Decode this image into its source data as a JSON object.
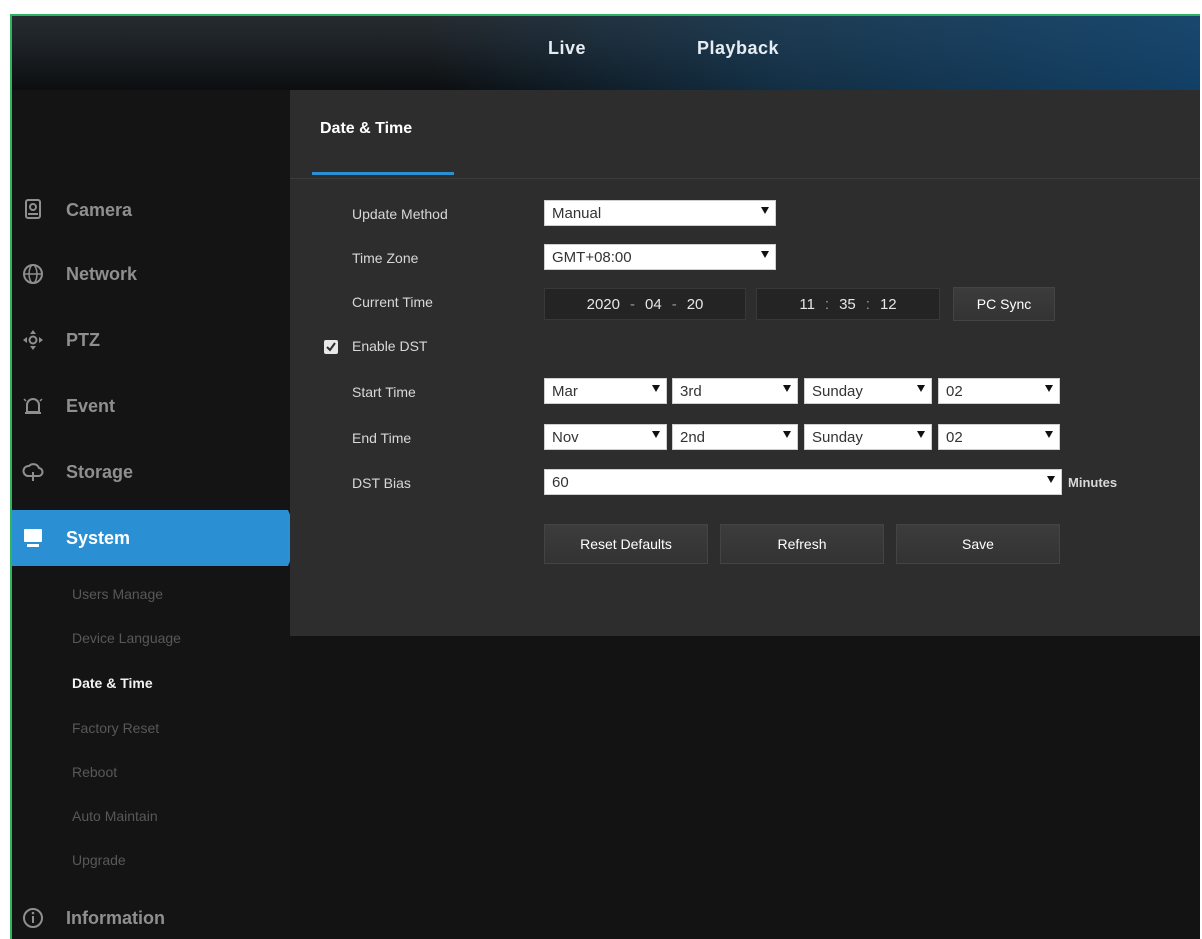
{
  "topnav": {
    "live": "Live",
    "playback": "Playback"
  },
  "sidebar": {
    "items": [
      {
        "label": "Camera",
        "icon": "camera-icon"
      },
      {
        "label": "Network",
        "icon": "network-icon"
      },
      {
        "label": "PTZ",
        "icon": "ptz-icon"
      },
      {
        "label": "Event",
        "icon": "event-icon"
      },
      {
        "label": "Storage",
        "icon": "storage-icon"
      },
      {
        "label": "System",
        "icon": "system-icon",
        "active": true
      },
      {
        "label": "Information",
        "icon": "info-icon"
      }
    ],
    "system_sub": [
      "Users Manage",
      "Device Language",
      "Date & Time",
      "Factory Reset",
      "Reboot",
      "Auto Maintain",
      "Upgrade"
    ]
  },
  "panel": {
    "title": "Date & Time",
    "update_method": {
      "label": "Update Method",
      "value": "Manual"
    },
    "time_zone": {
      "label": "Time Zone",
      "value": "GMT+08:00"
    },
    "current_time": {
      "label": "Current Time",
      "year": "2020",
      "month": "04",
      "day": "20",
      "hour": "11",
      "minute": "35",
      "second": "12",
      "date_sep": "-",
      "time_sep": ":"
    },
    "pc_sync": "PC Sync",
    "enable_dst": {
      "label": "Enable DST",
      "checked": true
    },
    "start_time": {
      "label": "Start Time",
      "month": "Mar",
      "week": "3rd",
      "day": "Sunday",
      "hour": "02"
    },
    "end_time": {
      "label": "End Time",
      "month": "Nov",
      "week": "2nd",
      "day": "Sunday",
      "hour": "02"
    },
    "dst_bias": {
      "label": "DST Bias",
      "value": "60",
      "unit": "Minutes"
    },
    "buttons": {
      "reset": "Reset Defaults",
      "refresh": "Refresh",
      "save": "Save"
    }
  },
  "colors": {
    "accent": "#2a8fd3",
    "panel": "#2d2d2d",
    "background": "#131313"
  }
}
